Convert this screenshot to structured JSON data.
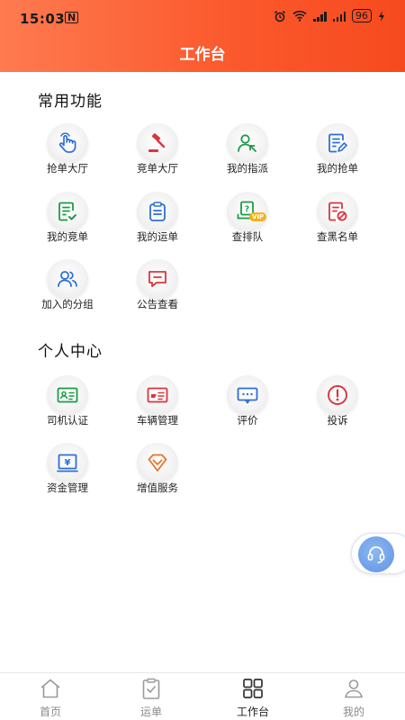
{
  "status_bar": {
    "time": "15:03",
    "nfc_icon": "N",
    "battery": "96"
  },
  "header": {
    "title": "工作台"
  },
  "common": {
    "title": "常用功能",
    "items": [
      {
        "label": "抢单大厅",
        "icon": "hand-tap-icon",
        "color": "#2f6fd6"
      },
      {
        "label": "竞单大厅",
        "icon": "gavel-icon",
        "color": "#d9363e"
      },
      {
        "label": "我的指派",
        "icon": "user-assign-icon",
        "color": "#1e9b4a"
      },
      {
        "label": "我的抢单",
        "icon": "document-icon",
        "color": "#2f6fd6"
      },
      {
        "label": "我的竞单",
        "icon": "doc-check-icon",
        "color": "#1e9b4a"
      },
      {
        "label": "我的运单",
        "icon": "clipboard-icon",
        "color": "#2f6fd6"
      },
      {
        "label": "查排队",
        "icon": "queue-vip-icon",
        "color": "#1e9b4a",
        "badge": "VIP"
      },
      {
        "label": "查黑名单",
        "icon": "blacklist-icon",
        "color": "#d9363e"
      },
      {
        "label": "加入的分组",
        "icon": "group-icon",
        "color": "#2f6fd6"
      },
      {
        "label": "公告查看",
        "icon": "announcement-icon",
        "color": "#d9363e"
      }
    ]
  },
  "personal": {
    "title": "个人中心",
    "items": [
      {
        "label": "司机认证",
        "icon": "id-card-icon",
        "color": "#1e9b4a"
      },
      {
        "label": "车辆管理",
        "icon": "vehicle-card-icon",
        "color": "#d9363e"
      },
      {
        "label": "评价",
        "icon": "comment-icon",
        "color": "#2f6fd6"
      },
      {
        "label": "投诉",
        "icon": "alert-circle-icon",
        "color": "#d9363e"
      },
      {
        "label": "资金管理",
        "icon": "money-icon",
        "color": "#2f6fd6"
      },
      {
        "label": "增值服务",
        "icon": "diamond-icon",
        "color": "#e8742a"
      }
    ]
  },
  "tabbar": {
    "tabs": [
      {
        "label": "首页",
        "icon": "home-icon"
      },
      {
        "label": "运单",
        "icon": "clipboard-tab-icon"
      },
      {
        "label": "工作台",
        "icon": "grid-icon",
        "active": true
      },
      {
        "label": "我的",
        "icon": "user-icon"
      }
    ]
  },
  "colors": {
    "header_start": "#ff7a50",
    "header_end": "#f64a1e",
    "accent_blue": "#2f6fd6",
    "accent_green": "#1e9b4a",
    "accent_red": "#d9363e"
  }
}
